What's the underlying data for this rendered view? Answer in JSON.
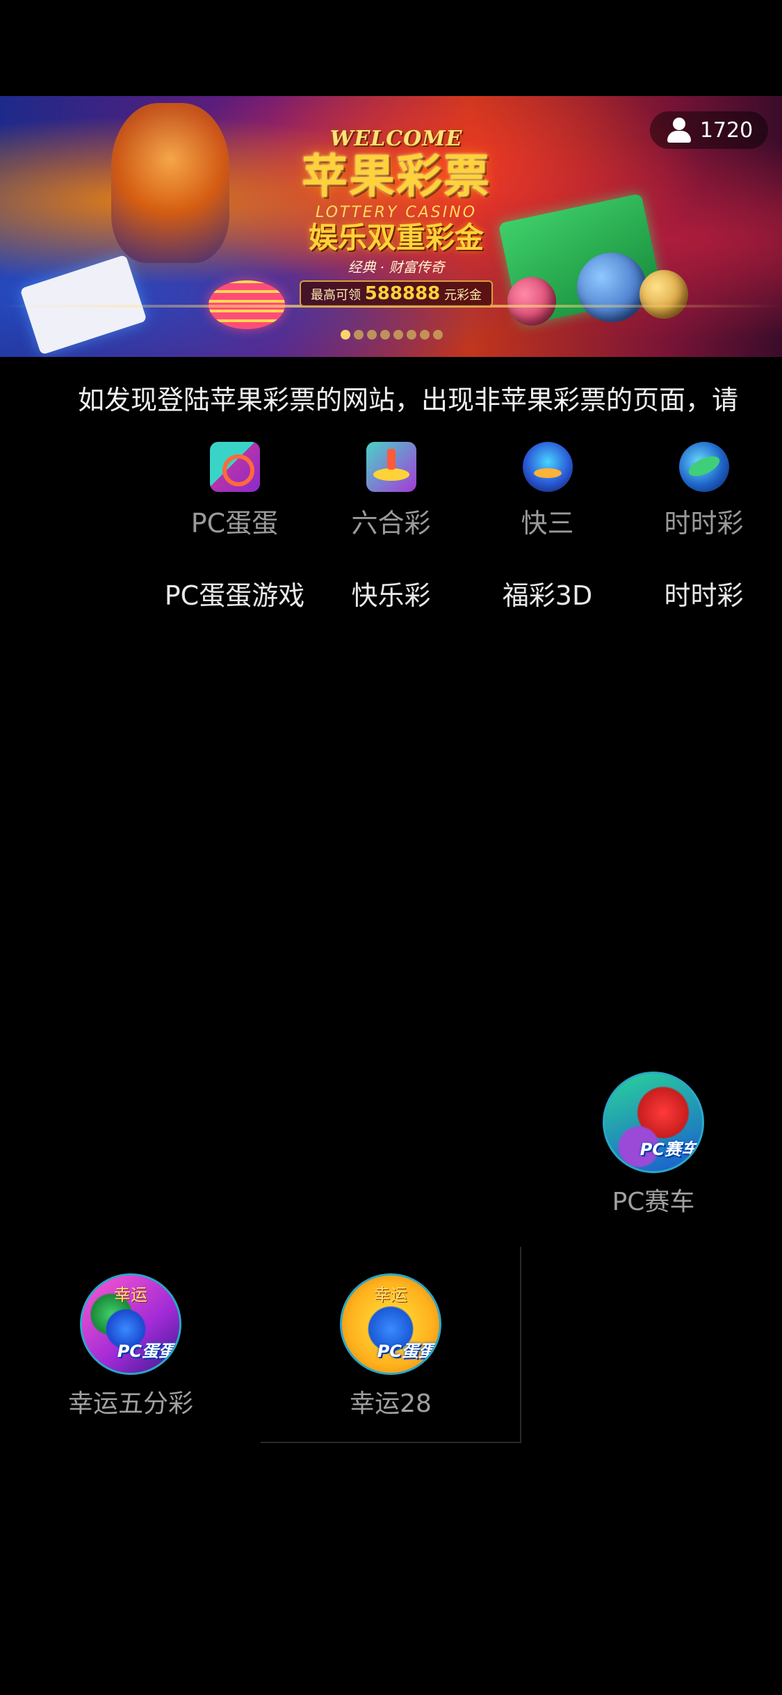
{
  "banner": {
    "welcome": "WELCOME",
    "brand": "苹果彩票",
    "casino": "LOTTERY CASINO",
    "slogan": "娱乐双重彩金",
    "tagline": "经典 · 财富传奇",
    "bonus_prefix": "最高可领",
    "bonus_amount": "588888",
    "bonus_suffix": "元彩金",
    "online_count": "1720",
    "slide_count": 8,
    "active_slide": 0
  },
  "notice": {
    "text": "如发现登陆苹果彩票的网站，出现非苹果彩票的页面，请"
  },
  "categories": [
    {
      "label": "PC蛋蛋",
      "icon": "cards-icon"
    },
    {
      "label": "六合彩",
      "icon": "gift-icon"
    },
    {
      "label": "快三",
      "icon": "trophy-icon"
    },
    {
      "label": "时时彩",
      "icon": "globe-icon"
    }
  ],
  "categories_row2": [
    {
      "label": "PC蛋蛋游戏"
    },
    {
      "label": "快乐彩"
    },
    {
      "label": "福彩3D"
    },
    {
      "label": "时时彩"
    }
  ],
  "games": [
    {
      "name": "PC赛车",
      "badge": "PC赛车",
      "top": ""
    },
    {
      "name": "幸运五分彩",
      "badge": "PC蛋蛋",
      "top": "幸运"
    },
    {
      "name": "幸运28",
      "badge": "PC蛋蛋",
      "top": "幸运"
    }
  ],
  "colors": {
    "background": "#000000",
    "accent_gold": "#ffd23a",
    "muted_text": "#9a9a9a"
  }
}
